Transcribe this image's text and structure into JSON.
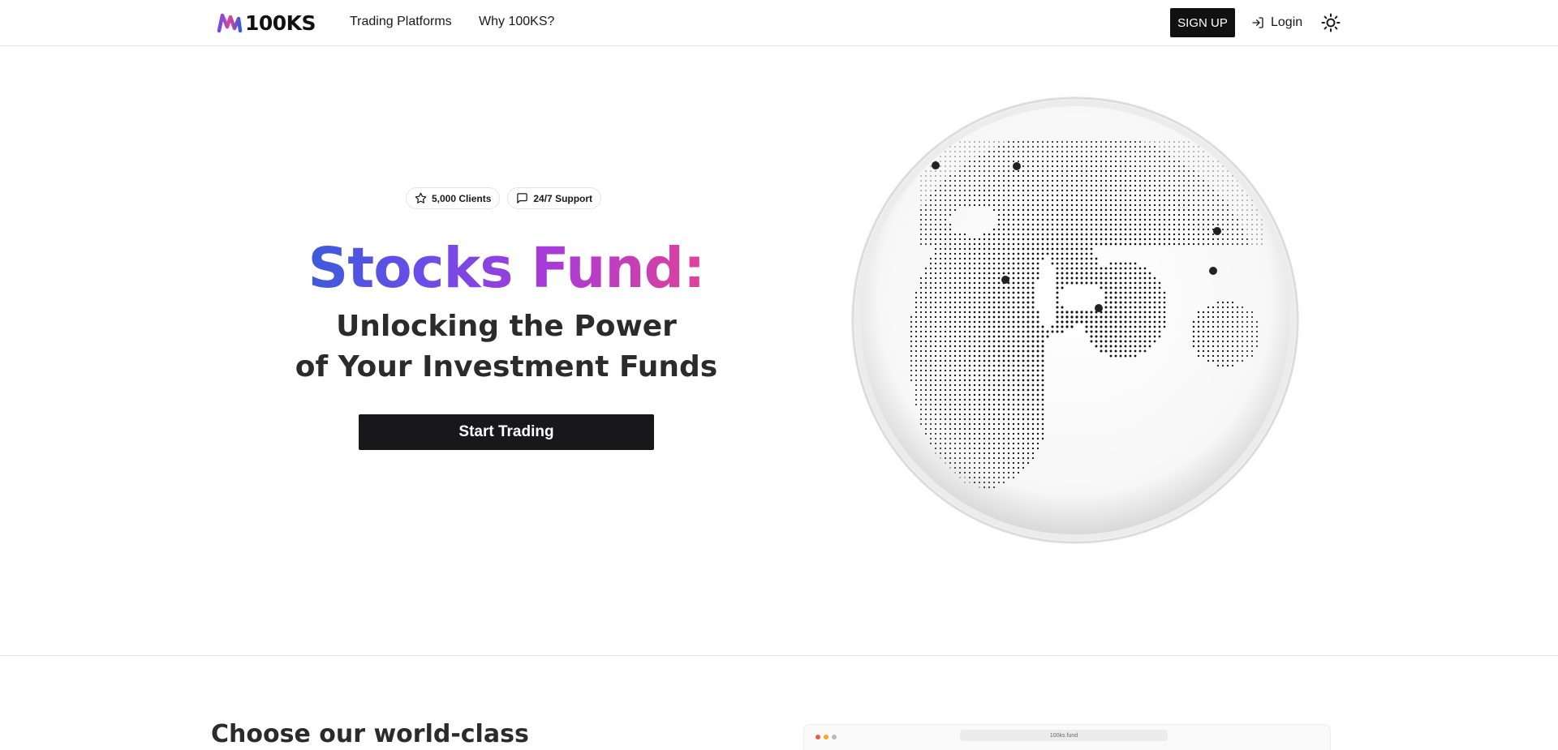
{
  "header": {
    "logo_text": "100KS",
    "nav": [
      "Trading Platforms",
      "Why 100KS?"
    ],
    "signup_label": "SIGN UP",
    "login_label": "Login",
    "theme_icon": "sun-icon"
  },
  "hero": {
    "badges": [
      {
        "icon": "star-icon",
        "label": "5,000 Clients"
      },
      {
        "icon": "message-square-icon",
        "label": "24/7 Support"
      }
    ],
    "title": "Stocks Fund:",
    "subtitle_line1": "Unlocking the Power",
    "subtitle_line2": "of Your Investment Funds",
    "cta_label": "Start Trading"
  },
  "section2": {
    "title": "Choose our world-class",
    "browser_url": "100ks.fund"
  },
  "colors": {
    "gradient_start": "#3b5bdb",
    "gradient_mid": "#a73ad8",
    "gradient_end": "#e0429a",
    "primary_dark": "#18181b",
    "traffic_red": "#f0594a",
    "traffic_orange": "#f5a623",
    "traffic_gray": "#b8b8b8"
  }
}
